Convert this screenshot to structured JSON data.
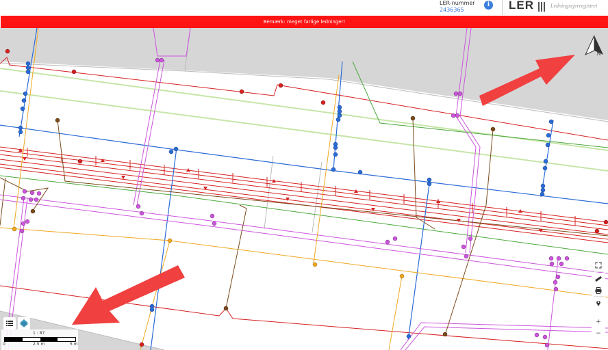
{
  "header": {
    "ler_label": "LER-nummer",
    "ler_number": "2436365",
    "info_icon": "info-icon",
    "logo_text": "LER",
    "logo_sub": "Ledningsejerregistret"
  },
  "banner": {
    "text": "Bemærk: meget farlige ledninger!",
    "color": "#ff1414"
  },
  "map": {
    "scale_ratio": "1 : 87",
    "scale_labels": [
      "0",
      "2.5 m",
      "5 m"
    ],
    "colors": {
      "electric": "#d62020",
      "water": "#2a6bd6",
      "telecom": "#cc55dd",
      "sewer": "#7a4a1a",
      "gas": "#f0a820",
      "district_heat": "#4aa83a",
      "parcel": "#cfcfcf"
    }
  },
  "controls": {
    "fullscreen": "fullscreen-icon",
    "measure": "ruler-icon",
    "print": "print-icon",
    "locate": "location-pin-icon",
    "zoom_in": "+",
    "zoom_out": "−",
    "layers": "layers-list-icon",
    "basemap": "basemap-icon",
    "north": "north-arrow-icon",
    "north_label": "N"
  }
}
